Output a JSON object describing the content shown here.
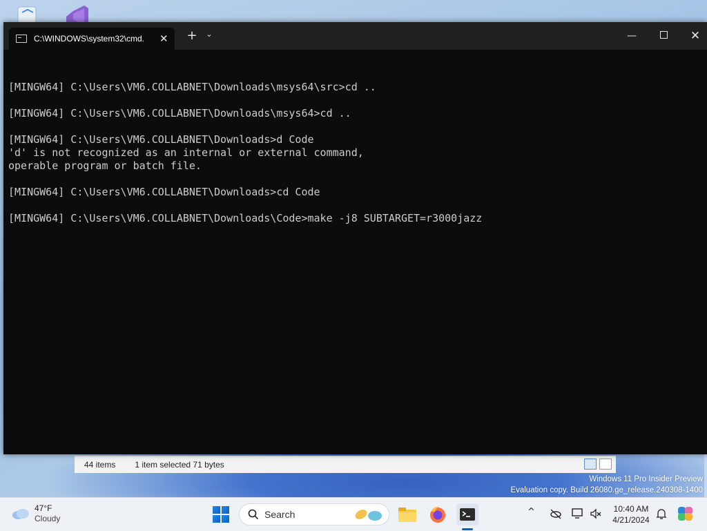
{
  "desktop": {
    "icons": [
      "recycle-bin-icon",
      "visual-studio-icon"
    ],
    "watermark": {
      "line1": "Windows 11 Pro Insider Preview",
      "line2": "Evaluation copy. Build 26080.ge_release.240308-1400"
    }
  },
  "explorer": {
    "items_count": "44 items",
    "selection": "1 item selected  71 bytes"
  },
  "terminal": {
    "tab_title": "C:\\WINDOWS\\system32\\cmd.",
    "new_tab": "+",
    "dropdown": "⌄",
    "minimize": "—",
    "close_tab": "✕",
    "close_window": "✕",
    "lines": [
      "",
      "[MINGW64] C:\\Users\\VM6.COLLABNET\\Downloads\\msys64\\src>cd ..",
      "",
      "[MINGW64] C:\\Users\\VM6.COLLABNET\\Downloads\\msys64>cd ..",
      "",
      "[MINGW64] C:\\Users\\VM6.COLLABNET\\Downloads>d Code",
      "'d' is not recognized as an internal or external command,",
      "operable program or batch file.",
      "",
      "[MINGW64] C:\\Users\\VM6.COLLABNET\\Downloads>cd Code",
      "",
      "[MINGW64] C:\\Users\\VM6.COLLABNET\\Downloads\\Code>make -j8 SUBTARGET=r3000jazz"
    ],
    "colors": {
      "background": "#0c0c0c",
      "text": "#cccccc",
      "titlebar": "#202020"
    }
  },
  "taskbar": {
    "weather": {
      "temp": "47°F",
      "condition": "Cloudy"
    },
    "search_label": "Search",
    "apps": [
      "file-explorer-icon",
      "firefox-icon",
      "terminal-icon"
    ],
    "tray_chevron": "^",
    "clock": {
      "time": "10:40 AM",
      "date": "4/21/2024"
    },
    "accent": "#0067c0"
  }
}
